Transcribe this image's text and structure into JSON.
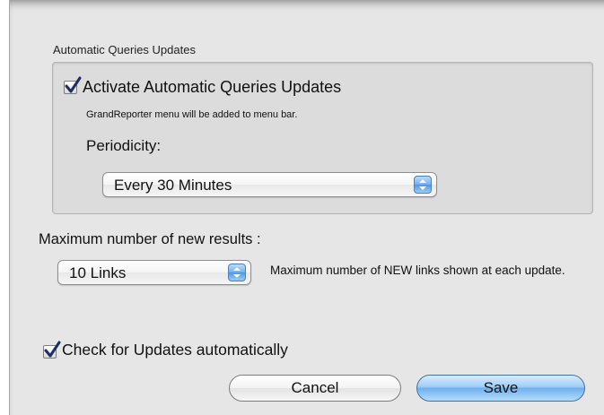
{
  "auto_updates_group": {
    "title": "Automatic Queries Updates",
    "activate_checkbox": {
      "label": "Activate Automatic Queries Updates",
      "checked": true
    },
    "note": "GrandReporter menu will be added to menu bar.",
    "periodicity_label": "Periodicity:",
    "periodicity_select": {
      "value": "Every 30 Minutes"
    }
  },
  "max_results": {
    "label": "Maximum number of new results :",
    "select": {
      "value": "10 Links"
    },
    "description": "Maximum number of NEW links shown at each update."
  },
  "check_updates_checkbox": {
    "label": "Check for Updates automatically",
    "checked": true
  },
  "buttons": {
    "cancel": "Cancel",
    "save": "Save"
  },
  "colors": {
    "checkmark": "#1c2f5e",
    "accent_blue": "#6fb0ee",
    "sheet_background": "#e6e6e6"
  }
}
